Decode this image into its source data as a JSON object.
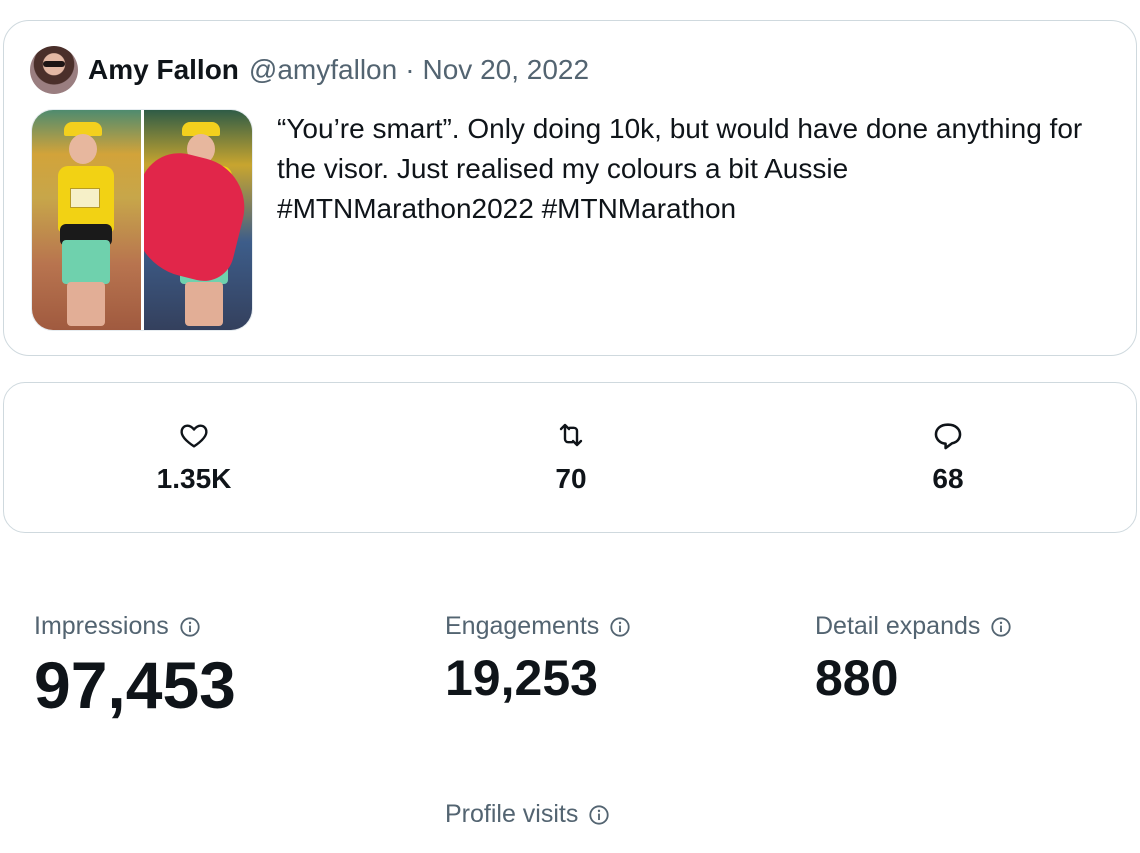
{
  "tweet": {
    "author_name": "Amy Fallon",
    "handle": "@amyfallon",
    "separator": "·",
    "date": "Nov 20, 2022",
    "text": "“You’re smart”. Only doing 10k, but would have done anything for the visor. Just realised my colours a bit Aussie #MTNMarathon2022 #MTNMarathon"
  },
  "engagement": {
    "likes": {
      "icon": "heart-icon",
      "count": "1.35K"
    },
    "retweets": {
      "icon": "retweet-icon",
      "count": "70"
    },
    "replies": {
      "icon": "reply-icon",
      "count": "68"
    }
  },
  "metrics": {
    "impressions": {
      "label": "Impressions",
      "value": "97,453"
    },
    "engagements": {
      "label": "Engagements",
      "value": "19,253"
    },
    "detail_expands": {
      "label": "Detail expands",
      "value": "880"
    },
    "profile_visits": {
      "label": "Profile visits"
    }
  },
  "colors": {
    "text": "#0f1419",
    "secondary": "#536471",
    "border": "#cfd9de"
  }
}
